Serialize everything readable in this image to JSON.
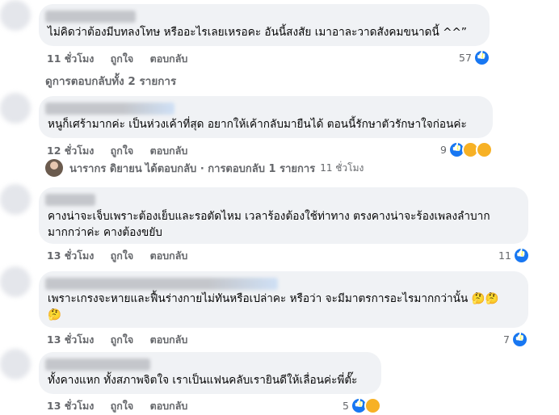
{
  "comments": [
    {
      "lines": [
        "ไม่คิดว่าต้องมีบทลงโทษ หรืออะไรเลยเหรอคะ อันนี้สงสัย เมาอาละวาดสังคมขนาดนี้ ^^”"
      ],
      "time": "11 ชั่วโมง",
      "like": "ถูกใจ",
      "reply": "ตอบกลับ",
      "count": "57"
    },
    {
      "lines": [
        "หนูก็เศร้ามากค่ะ เป็นห่วงเค้าที่สุด อยากให้เค้ากลับมายืนได้ ตอนนี้รักษาตัวรักษาใจก่อนค่ะ"
      ],
      "time": "12 ชั่วโมง",
      "like": "ถูกใจ",
      "reply": "ตอบกลับ",
      "count": "9"
    },
    {
      "lines": [
        "คางน่าจะเจ็บเพราะต้องเย็บและรอตัดไหม เวลาร้องต้องใช้ท่าทาง ตรงคางน่าจะร้องเพลงลำบาก",
        "มากกว่าค่ะ คางต้องขยับ"
      ],
      "time": "13 ชั่วโมง",
      "like": "ถูกใจ",
      "reply": "ตอบกลับ",
      "count": "11"
    },
    {
      "lines": [
        "เพราะเกรงจะหายและฟื้นร่างกายไม่ทันหรือเปล่าคะ หรือว่า จะมีมาตรการอะไรมากกว่านั้น 🤔🤔",
        "🤔"
      ],
      "time": "13 ชั่วโมง",
      "like": "ถูกใจ",
      "reply": "ตอบกลับ",
      "count": "7"
    },
    {
      "lines": [
        "ทั้งคางแหก ทั้งสภาพจิตใจ เราเป็นแฟนคลับเรายินดีให้เลื่อนค่ะพี่ตั๊ะ"
      ],
      "time": "13 ชั่วโมง",
      "like": "ถูกใจ",
      "reply": "ตอบกลับ",
      "count": "5"
    }
  ],
  "view_replies": "ดูการตอบกลับทั้ง 2 รายการ",
  "reply_summary": {
    "name": "นารากร ดิยายน",
    "text": "ได้ตอบกลับ · การตอบกลับ 1 รายการ",
    "time": "11 ชั่วโมง"
  },
  "icons": {
    "like": "like-reaction-icon",
    "haha": "haha-reaction-icon",
    "care": "care-reaction-icon"
  },
  "colors": {
    "bubble": "#f0f2f5",
    "meta": "#65676b",
    "like_blue": "#1877f2"
  }
}
